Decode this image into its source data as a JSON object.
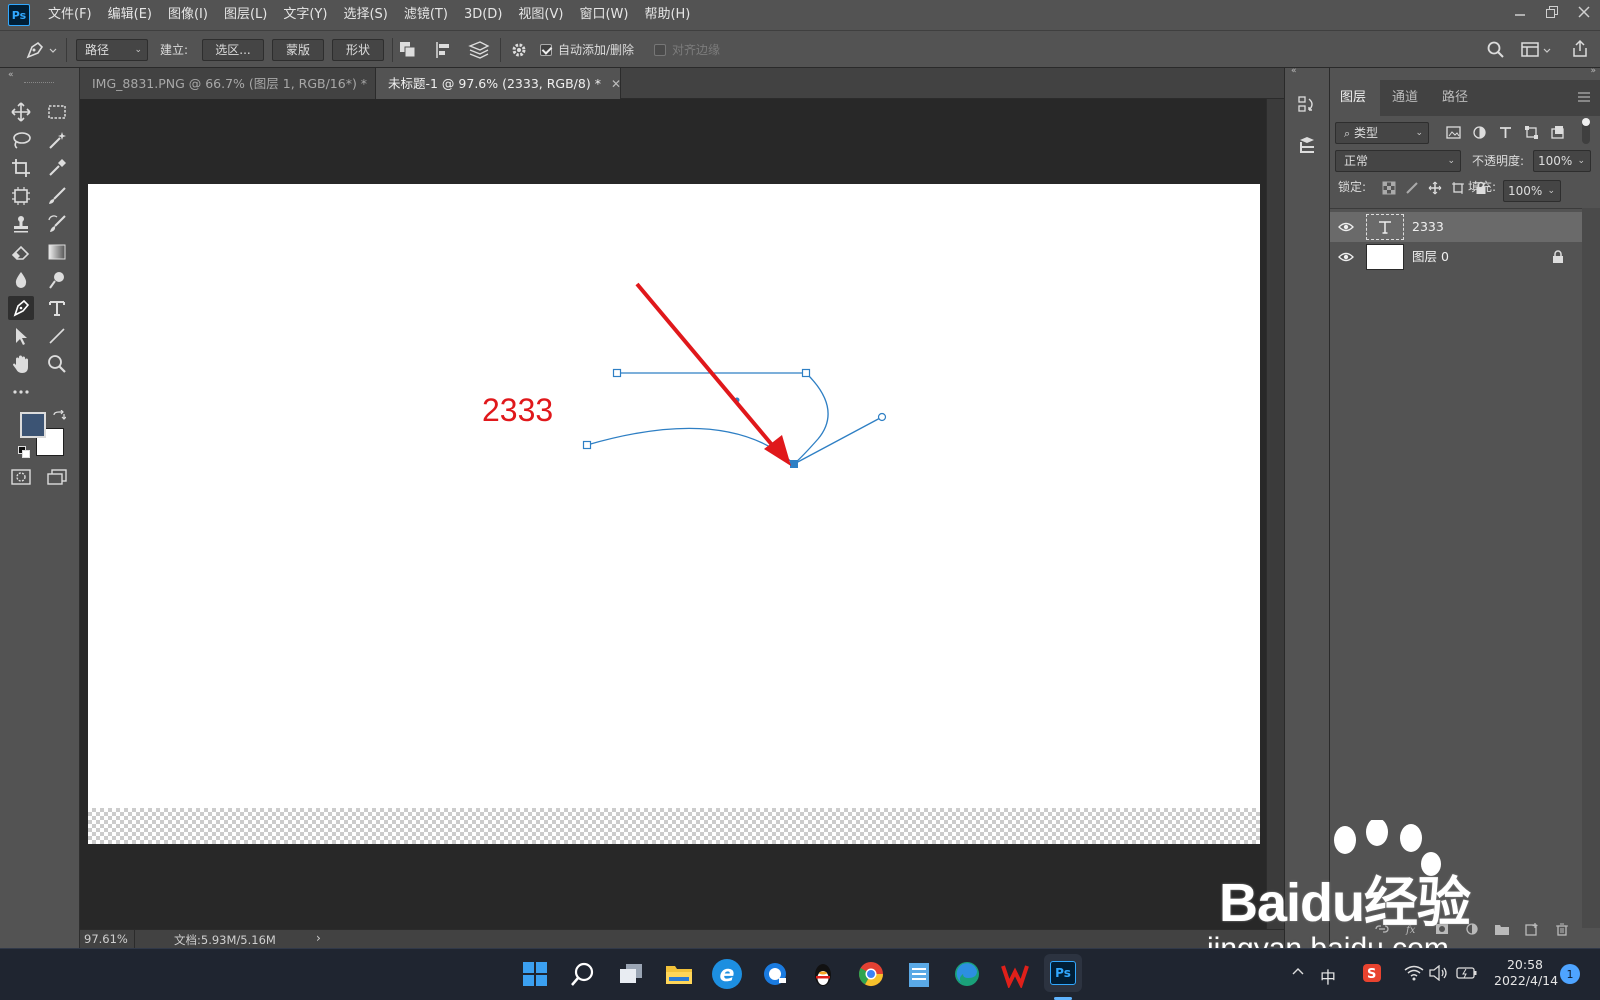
{
  "menubar": {
    "logo": "Ps",
    "items": [
      "文件(F)",
      "编辑(E)",
      "图像(I)",
      "图层(L)",
      "文字(Y)",
      "选择(S)",
      "滤镜(T)",
      "3D(D)",
      "视图(V)",
      "窗口(W)",
      "帮助(H)"
    ]
  },
  "options": {
    "mode_select": "路径",
    "make_label": "建立:",
    "selection_button": "选区...",
    "mask_button": "蒙版",
    "shape_button": "形状",
    "auto_add_delete": "自动添加/删除",
    "align_edges": "对齐边缘",
    "auto_add_checked": true,
    "align_edges_checked": false
  },
  "tabs": [
    {
      "label": "IMG_8831.PNG @ 66.7% (图层 1, RGB/16*) *",
      "active": false
    },
    {
      "label": "未标题-1 @ 97.6% (2333, RGB/8) *",
      "active": true
    }
  ],
  "canvas": {
    "text": "2333",
    "text_color": "#e0181b",
    "path_color": "#2e7fc4",
    "arrow_color": "#e0181b"
  },
  "status": {
    "zoom": "97.61%",
    "doc": "文档:5.93M/5.16M"
  },
  "colors": {
    "foreground": "#3c5474",
    "background": "#ffffff"
  },
  "layers_panel": {
    "tabs": [
      "图层",
      "通道",
      "路径"
    ],
    "filter_label": "类型",
    "blend_mode": "正常",
    "opacity_label": "不透明度:",
    "opacity_value": "100%",
    "lock_label": "锁定:",
    "fill_label": "填充:",
    "fill_value": "100%",
    "layers": [
      {
        "name": "2333",
        "type": "text",
        "selected": true,
        "locked": false
      },
      {
        "name": "图层 0",
        "type": "pixel",
        "selected": false,
        "locked": true
      }
    ]
  },
  "taskbar": {
    "input_method": "中",
    "time": "20:58",
    "date": "2022/4/14",
    "notification_count": "1"
  },
  "watermark": {
    "brand": "Baidu经验",
    "url": "jingyan.baidu.com"
  }
}
